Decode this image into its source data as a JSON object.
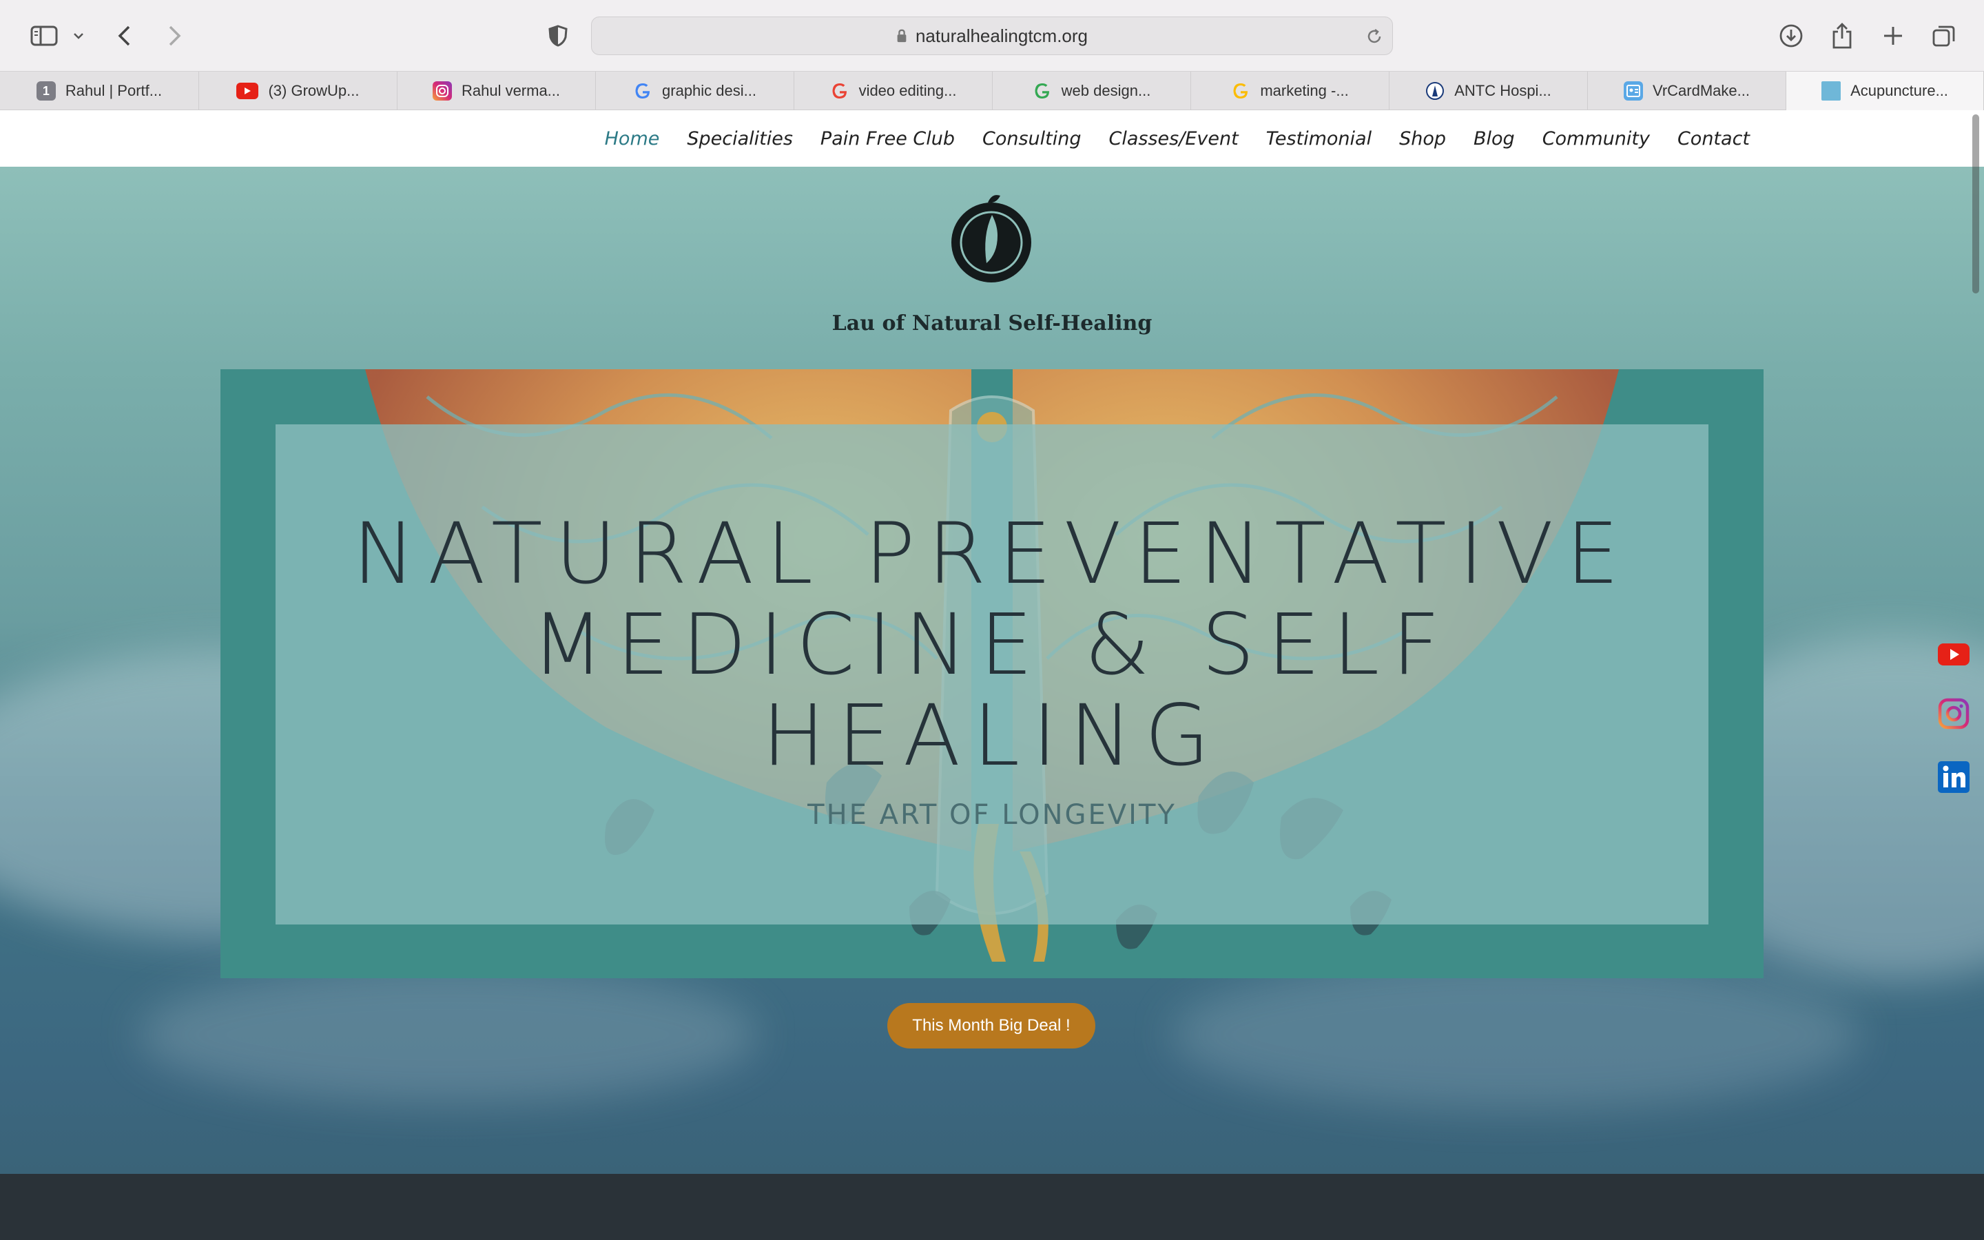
{
  "browser": {
    "url": "naturalhealingtcm.org",
    "tabs": [
      {
        "label": "Rahul | Portf...",
        "icon": "numbered-tab-icon",
        "badge": "1",
        "color": "#7d7d85"
      },
      {
        "label": "(3) GrowUp...",
        "icon": "youtube-icon",
        "color": "#e62117"
      },
      {
        "label": "Rahul verma...",
        "icon": "instagram-icon",
        "color": "#c1358d"
      },
      {
        "label": "graphic desi...",
        "icon": "google-icon",
        "color": "#4285f4"
      },
      {
        "label": "video editing...",
        "icon": "google-icon",
        "color": "#4285f4"
      },
      {
        "label": "web design...",
        "icon": "google-icon",
        "color": "#4285f4"
      },
      {
        "label": "marketing -...",
        "icon": "google-icon",
        "color": "#4285f4"
      },
      {
        "label": "ANTC Hospi...",
        "icon": "antc-icon",
        "color": "#1b3b7a"
      },
      {
        "label": "VrCardMake...",
        "icon": "contact-card-icon",
        "color": "#5aa8e6"
      },
      {
        "label": "Acupuncture...",
        "icon": "site-favicon",
        "color": "#6fb7d8"
      }
    ]
  },
  "nav": {
    "items": [
      "Home",
      "Specialities",
      "Pain Free Club",
      "Consulting",
      "Classes/Event",
      "Testimonial",
      "Shop",
      "Blog",
      "Community",
      "Contact"
    ],
    "active": "Home",
    "active_color": "#2c7a86"
  },
  "hero": {
    "logo_text": "Lau of Natural Self-Healing",
    "headline_lines": [
      "NATURAL PREVENTATIVE",
      "MEDICINE & SELF",
      "HEALING"
    ],
    "subtitle": "THE ART OF LONGEVITY",
    "cta": "This Month Big Deal !",
    "cta_color": "#b8781e",
    "frame_color": "#3f8d88"
  },
  "social": [
    "youtube-icon",
    "instagram-icon",
    "linkedin-icon"
  ]
}
